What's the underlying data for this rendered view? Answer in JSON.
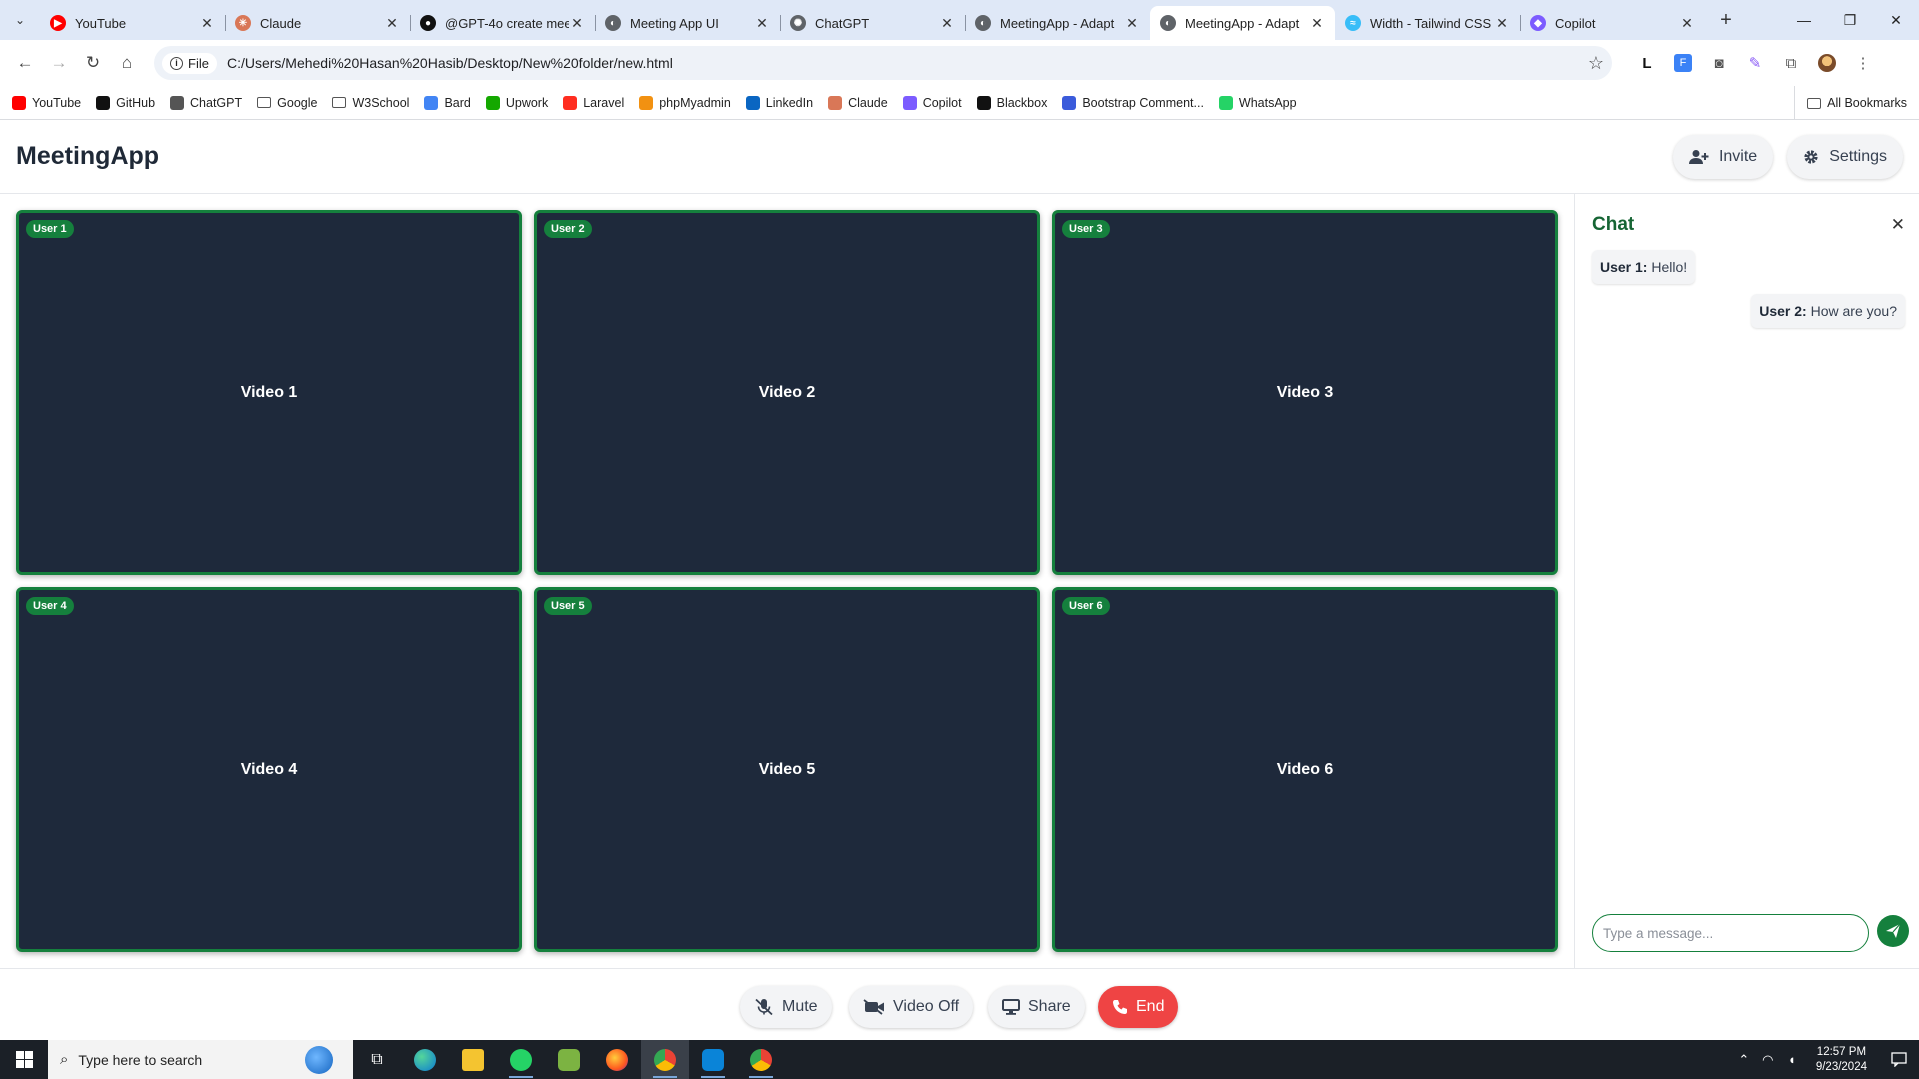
{
  "browser": {
    "tabs": [
      {
        "title": "YouTube",
        "color": "#ff0000",
        "glyph": "▶"
      },
      {
        "title": "Claude",
        "color": "#d97757",
        "glyph": "✳"
      },
      {
        "title": "@GPT-4o create mee",
        "color": "#111111",
        "glyph": "●"
      },
      {
        "title": "Meeting App UI",
        "color": "#5f6368",
        "glyph": "◐"
      },
      {
        "title": "ChatGPT",
        "color": "#5f6368",
        "glyph": "✺"
      },
      {
        "title": "MeetingApp - Adapt",
        "color": "#5f6368",
        "glyph": "◐"
      },
      {
        "title": "MeetingApp - Adapt",
        "color": "#5f6368",
        "glyph": "◐"
      },
      {
        "title": "Width - Tailwind CSS",
        "color": "#38bdf8",
        "glyph": "≈"
      },
      {
        "title": "Copilot",
        "color": "#7c5cff",
        "glyph": "◆"
      }
    ],
    "active_tab_index": 6,
    "site_chip": "File",
    "url": "C:/Users/Mehedi%20Hasan%20Hasib/Desktop/New%20folder/new.html",
    "bookmarks": [
      {
        "label": "YouTube",
        "type": "site",
        "color": "#ff0000"
      },
      {
        "label": "GitHub",
        "type": "site",
        "color": "#111111"
      },
      {
        "label": "ChatGPT",
        "type": "site",
        "color": "#555555"
      },
      {
        "label": "Google",
        "type": "folder"
      },
      {
        "label": "W3School",
        "type": "folder"
      },
      {
        "label": "Bard",
        "type": "site",
        "color": "#4285f4"
      },
      {
        "label": "Upwork",
        "type": "site",
        "color": "#14a800"
      },
      {
        "label": "Laravel",
        "type": "site",
        "color": "#ff2d20"
      },
      {
        "label": "phpMyadmin",
        "type": "site",
        "color": "#f29111"
      },
      {
        "label": "LinkedIn",
        "type": "site",
        "color": "#0a66c2"
      },
      {
        "label": "Claude",
        "type": "site",
        "color": "#d97757"
      },
      {
        "label": "Copilot",
        "type": "site",
        "color": "#7c5cff"
      },
      {
        "label": "Blackbox",
        "type": "site",
        "color": "#111111"
      },
      {
        "label": "Bootstrap Comment...",
        "type": "site",
        "color": "#3b5bdb"
      },
      {
        "label": "WhatsApp",
        "type": "site",
        "color": "#25d366"
      }
    ],
    "all_bookmarks_label": "All Bookmarks"
  },
  "app": {
    "logo": "MeetingApp",
    "invite_label": "Invite",
    "settings_label": "Settings",
    "accent_color": "#15803d",
    "video_tiles": [
      {
        "user": "User 1",
        "label": "Video 1"
      },
      {
        "user": "User 2",
        "label": "Video 2"
      },
      {
        "user": "User 3",
        "label": "Video 3"
      },
      {
        "user": "User 4",
        "label": "Video 4"
      },
      {
        "user": "User 5",
        "label": "Video 5"
      },
      {
        "user": "User 6",
        "label": "Video 6"
      }
    ],
    "chat": {
      "title": "Chat",
      "messages": [
        {
          "sender": "User 1:",
          "text": "Hello!",
          "align": "left"
        },
        {
          "sender": "User 2:",
          "text": "How are you?",
          "align": "right"
        }
      ],
      "input_placeholder": "Type a message..."
    },
    "controls": {
      "mute_label": "Mute",
      "video_off_label": "Video Off",
      "share_label": "Share",
      "end_label": "End"
    }
  },
  "taskbar": {
    "search_placeholder": "Type here to search",
    "time": "12:57 PM",
    "date": "9/23/2024"
  }
}
